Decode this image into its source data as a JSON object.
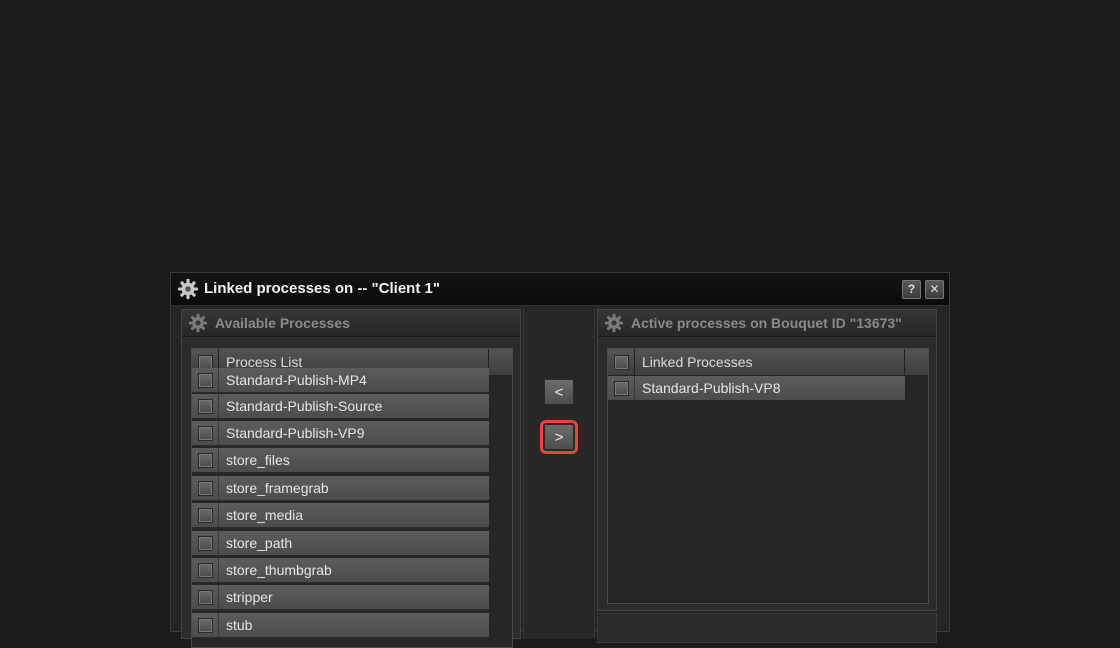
{
  "dialog": {
    "title": "Linked processes on -- \"Client 1\"",
    "help_label": "?",
    "close_label": "✕"
  },
  "available": {
    "title": "Available Processes",
    "column_header": "Process List",
    "items": [
      "Standard-Publish-MP4",
      "Standard-Publish-Source",
      "Standard-Publish-VP9",
      "store_files",
      "store_framegrab",
      "store_media",
      "store_path",
      "store_thumbgrab",
      "stripper",
      "stub"
    ]
  },
  "active": {
    "title": "Active processes on Bouquet ID \"13673\"",
    "column_header": "Linked Processes",
    "items": [
      "Standard-Publish-VP8"
    ]
  },
  "transfer": {
    "remove_label": "<",
    "add_label": ">"
  },
  "colors": {
    "highlight": "#e8453c",
    "background": "#1c1c1c"
  }
}
